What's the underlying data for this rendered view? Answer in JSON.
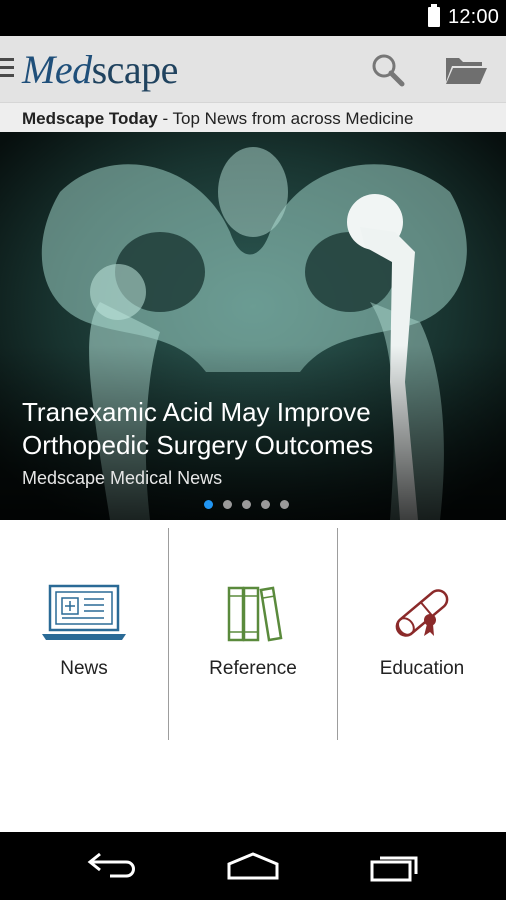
{
  "status_bar": {
    "time": "12:00"
  },
  "app_bar": {
    "logo": {
      "prefix": "Med",
      "suffix": "scape"
    },
    "icons": [
      "menu-icon",
      "search-icon",
      "folder-icon"
    ]
  },
  "subheader": {
    "title": "Medscape Today",
    "text": " - Top News from across Medicine"
  },
  "hero": {
    "headline_line1": "Tranexamic Acid May Improve",
    "headline_line2": "Orthopedic Surgery Outcomes",
    "source": "Medscape Medical News",
    "slides_total": 5,
    "active_slide": 1
  },
  "tiles": [
    {
      "label": "News",
      "icon": "news-laptop-icon",
      "color": "#2a6a96"
    },
    {
      "label": "Reference",
      "icon": "books-icon",
      "color": "#5a8a3c"
    },
    {
      "label": "Education",
      "icon": "diploma-icon",
      "color": "#8b2a2a"
    }
  ],
  "nav_bar": {
    "icons": [
      "back-icon",
      "home-icon",
      "recents-icon"
    ]
  }
}
